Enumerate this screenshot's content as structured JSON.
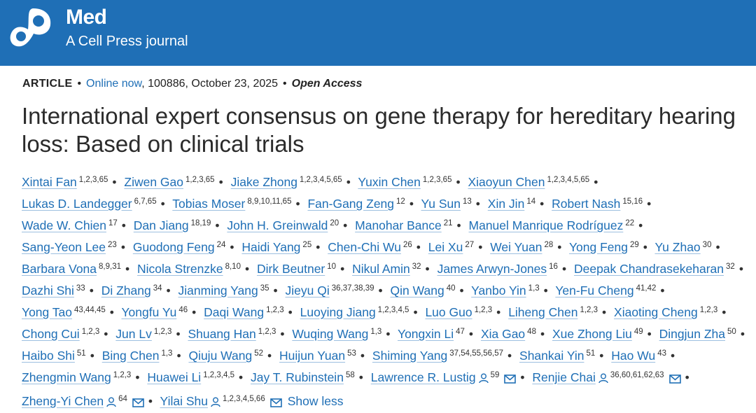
{
  "journal": {
    "name": "Med",
    "subtitle": "A Cell Press journal"
  },
  "meta": {
    "type": "ARTICLE",
    "online": "Online now",
    "rest": ", 100886, October 23, 2025",
    "access": "Open Access"
  },
  "title": "International expert consensus on gene therapy for hereditary hearing loss: Based on clinical trials",
  "authors": [
    {
      "name": "Xintai Fan",
      "aff": "1,2,3,65"
    },
    {
      "name": "Ziwen Gao",
      "aff": "1,2,3,65"
    },
    {
      "name": "Jiake Zhong",
      "aff": "1,2,3,4,5,65"
    },
    {
      "name": "Yuxin Chen",
      "aff": "1,2,3,65"
    },
    {
      "name": "Xiaoyun Chen",
      "aff": "1,2,3,4,5,65"
    },
    {
      "name": "Lukas D. Landegger",
      "aff": "6,7,65"
    },
    {
      "name": "Tobias Moser",
      "aff": "8,9,10,11,65"
    },
    {
      "name": "Fan-Gang Zeng",
      "aff": "12"
    },
    {
      "name": "Yu Sun",
      "aff": "13"
    },
    {
      "name": "Xin Jin",
      "aff": "14"
    },
    {
      "name": "Robert Nash",
      "aff": "15,16"
    },
    {
      "name": "Wade W. Chien",
      "aff": "17"
    },
    {
      "name": "Dan Jiang",
      "aff": "18,19"
    },
    {
      "name": "John H. Greinwald",
      "aff": "20"
    },
    {
      "name": "Manohar Bance",
      "aff": "21"
    },
    {
      "name": "Manuel Manrique Rodríguez",
      "aff": "22"
    },
    {
      "name": "Sang-Yeon Lee",
      "aff": "23"
    },
    {
      "name": "Guodong Feng",
      "aff": "24"
    },
    {
      "name": "Haidi Yang",
      "aff": "25"
    },
    {
      "name": "Chen-Chi Wu",
      "aff": "26"
    },
    {
      "name": "Lei Xu",
      "aff": "27"
    },
    {
      "name": "Wei Yuan",
      "aff": "28"
    },
    {
      "name": "Yong Feng",
      "aff": "29"
    },
    {
      "name": "Yu Zhao",
      "aff": "30"
    },
    {
      "name": "Barbara Vona",
      "aff": "8,9,31"
    },
    {
      "name": "Nicola Strenzke",
      "aff": "8,10"
    },
    {
      "name": "Dirk Beutner",
      "aff": "10"
    },
    {
      "name": "Nikul Amin",
      "aff": "32"
    },
    {
      "name": "James Arwyn-Jones",
      "aff": "16"
    },
    {
      "name": "Deepak Chandrasekeharan",
      "aff": "32"
    },
    {
      "name": "Dazhi Shi",
      "aff": "33"
    },
    {
      "name": "Di Zhang",
      "aff": "34"
    },
    {
      "name": "Jianming Yang",
      "aff": "35"
    },
    {
      "name": "Jieyu Qi",
      "aff": "36,37,38,39"
    },
    {
      "name": "Qin Wang",
      "aff": "40"
    },
    {
      "name": "Yanbo Yin",
      "aff": "1,3"
    },
    {
      "name": "Yen-Fu Cheng",
      "aff": "41,42"
    },
    {
      "name": "Yong Tao",
      "aff": "43,44,45"
    },
    {
      "name": "Yongfu Yu",
      "aff": "46"
    },
    {
      "name": "Daqi Wang",
      "aff": "1,2,3"
    },
    {
      "name": "Luoying Jiang",
      "aff": "1,2,3,4,5"
    },
    {
      "name": "Luo Guo",
      "aff": "1,2,3"
    },
    {
      "name": "Liheng Chen",
      "aff": "1,2,3"
    },
    {
      "name": "Xiaoting Cheng",
      "aff": "1,2,3"
    },
    {
      "name": "Chong Cui",
      "aff": "1,2,3"
    },
    {
      "name": "Jun Lv",
      "aff": "1,2,3"
    },
    {
      "name": "Shuang Han",
      "aff": "1,2,3"
    },
    {
      "name": "Wuqing Wang",
      "aff": "1,3"
    },
    {
      "name": "Yongxin Li",
      "aff": "47"
    },
    {
      "name": "Xia Gao",
      "aff": "48"
    },
    {
      "name": "Xue Zhong Liu",
      "aff": "49"
    },
    {
      "name": "Dingjun Zha",
      "aff": "50"
    },
    {
      "name": "Haibo Shi",
      "aff": "51"
    },
    {
      "name": "Bing Chen",
      "aff": "1,3"
    },
    {
      "name": "Qiuju Wang",
      "aff": "52"
    },
    {
      "name": "Huijun Yuan",
      "aff": "53"
    },
    {
      "name": "Shiming Yang",
      "aff": "37,54,55,56,57"
    },
    {
      "name": "Shankai Yin",
      "aff": "51"
    },
    {
      "name": "Hao Wu",
      "aff": "43"
    },
    {
      "name": "Zhengmin Wang",
      "aff": "1,2,3"
    },
    {
      "name": "Huawei Li",
      "aff": "1,2,3,4,5"
    },
    {
      "name": "Jay T. Rubinstein",
      "aff": "58"
    },
    {
      "name": "Lawrence R. Lustig",
      "aff": "59",
      "corr": true
    },
    {
      "name": "Renjie Chai",
      "aff": "36,60,61,62,63",
      "corr": true
    },
    {
      "name": "Zheng-Yi Chen",
      "aff": "64",
      "corr": true
    },
    {
      "name": "Yilai Shu",
      "aff": "1,2,3,4,5,66",
      "corr": true
    }
  ],
  "show_less": "Show less",
  "icons": {
    "corresponding": "person-icon",
    "email": "envelope-icon"
  },
  "colors": {
    "header": "#1f6fb6",
    "link": "#1f6fb6"
  }
}
